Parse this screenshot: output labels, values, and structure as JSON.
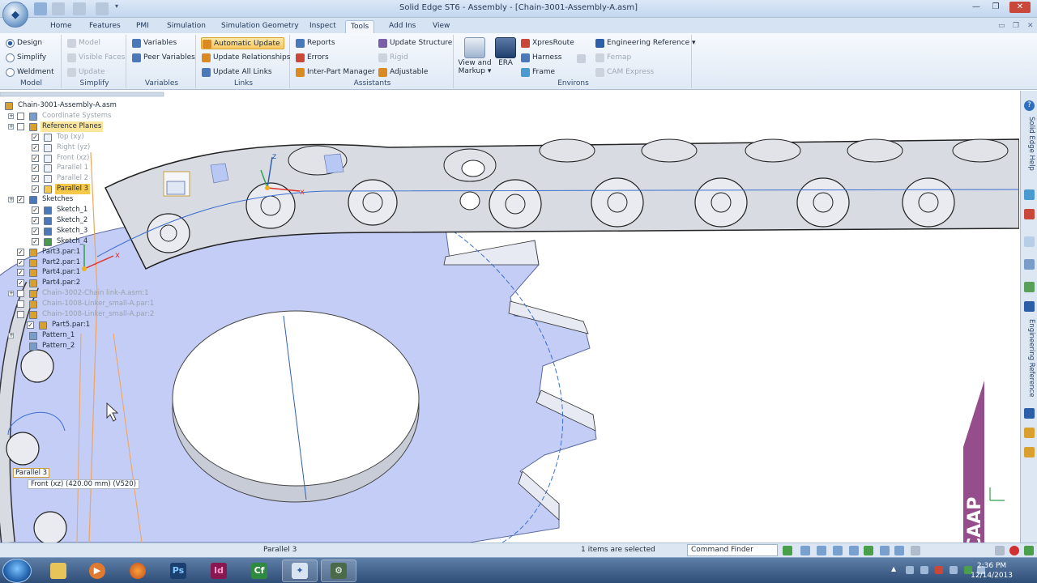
{
  "window": {
    "title": "Solid Edge ST6 - Assembly - [Chain-3001-Assembly-A.asm]",
    "controls": [
      "—",
      "❐",
      "✕"
    ]
  },
  "tabs": [
    "Home",
    "Features",
    "PMI",
    "Simulation",
    "Simulation Geometry",
    "Inspect",
    "Tools",
    "Add Ins",
    "View"
  ],
  "active_tab": "Tools",
  "ribbon": {
    "model": {
      "label": "Model",
      "design": "Design",
      "simplify": "Simplify",
      "weldment": "Weldment"
    },
    "simplify": {
      "label": "Simplify",
      "model": "Model",
      "visible_faces": "Visible Faces",
      "update": "Update"
    },
    "variables": {
      "label": "Variables",
      "variables": "Variables",
      "peer_variables": "Peer Variables"
    },
    "links": {
      "label": "Links",
      "automatic_update": "Automatic Update",
      "update_relationships": "Update Relationships",
      "update_all_links": "Update All Links"
    },
    "assistants": {
      "label": "Assistants",
      "reports": "Reports",
      "errors": "Errors",
      "inter_part_manager": "Inter-Part Manager",
      "update_structure": "Update Structure",
      "rigid": "Rigid",
      "adjustable": "Adjustable"
    },
    "environs": {
      "label": "Environs",
      "view_markup": "View and Markup",
      "era": "ERA",
      "xpresroute": "XpresRoute",
      "harness": "Harness",
      "frame": "Frame",
      "engineering_reference": "Engineering Reference",
      "femap": "Femap",
      "cam_express": "CAM Express"
    }
  },
  "tree": {
    "items": [
      {
        "label": "Chain-3001-Assembly-A.asm",
        "style": ""
      },
      {
        "label": "Coordinate Systems",
        "style": "dim"
      },
      {
        "label": "Reference Planes",
        "style": "hl"
      },
      {
        "label": "Top (xy)",
        "style": "dim"
      },
      {
        "label": "Right (yz)",
        "style": "dim"
      },
      {
        "label": "Front (xz)",
        "style": "dim"
      },
      {
        "label": "Parallel 1",
        "style": "dim"
      },
      {
        "label": "Parallel 2",
        "style": "dim"
      },
      {
        "label": "Parallel 3",
        "style": "sel"
      },
      {
        "label": "Sketches",
        "style": ""
      },
      {
        "label": "Sketch_1",
        "style": ""
      },
      {
        "label": "Sketch_2",
        "style": ""
      },
      {
        "label": "Sketch_3",
        "style": ""
      },
      {
        "label": "Sketch_4",
        "style": ""
      },
      {
        "label": "Part3.par:1",
        "style": ""
      },
      {
        "label": "Part2.par:1",
        "style": ""
      },
      {
        "label": "Part4.par:1",
        "style": ""
      },
      {
        "label": "Part4.par:2",
        "style": ""
      },
      {
        "label": "Chain-3002-Chain link-A.asm:1",
        "style": "dim"
      },
      {
        "label": "Chain-1008-Linker_small-A.par:1",
        "style": "dim"
      },
      {
        "label": "Chain-1008-Linker_small-A.par:2",
        "style": "dim"
      },
      {
        "label": "Part5.par:1",
        "style": ""
      },
      {
        "label": "Pattern_1",
        "style": ""
      },
      {
        "label": "Pattern_2",
        "style": ""
      }
    ]
  },
  "canvas": {
    "tooltip_title": "Parallel 3",
    "tooltip_detail": "Front (xz)   (420.00 mm)   (V520)",
    "triad_x": "x",
    "triad_z": "z"
  },
  "right_panel": {
    "tab1": "Solid Edge Help",
    "tab2": "Engineering Reference"
  },
  "status": {
    "prompt": "Parallel 3",
    "selection": "1 items are selected",
    "command_finder": "Command Finder"
  },
  "taskbar": {
    "time": "2:36 PM",
    "date": "12/14/2013",
    "apps": [
      "explorer",
      "media-player",
      "firefox",
      "Ps",
      "Id",
      "Cf",
      "solid-edge",
      "tools"
    ]
  },
  "watermark": "CAAP",
  "colors": {
    "accent": "#f6c84a",
    "sprocket": "#c2ccf4",
    "chain": "#d9dbe2",
    "pitch_line": "#3a6fd0"
  }
}
